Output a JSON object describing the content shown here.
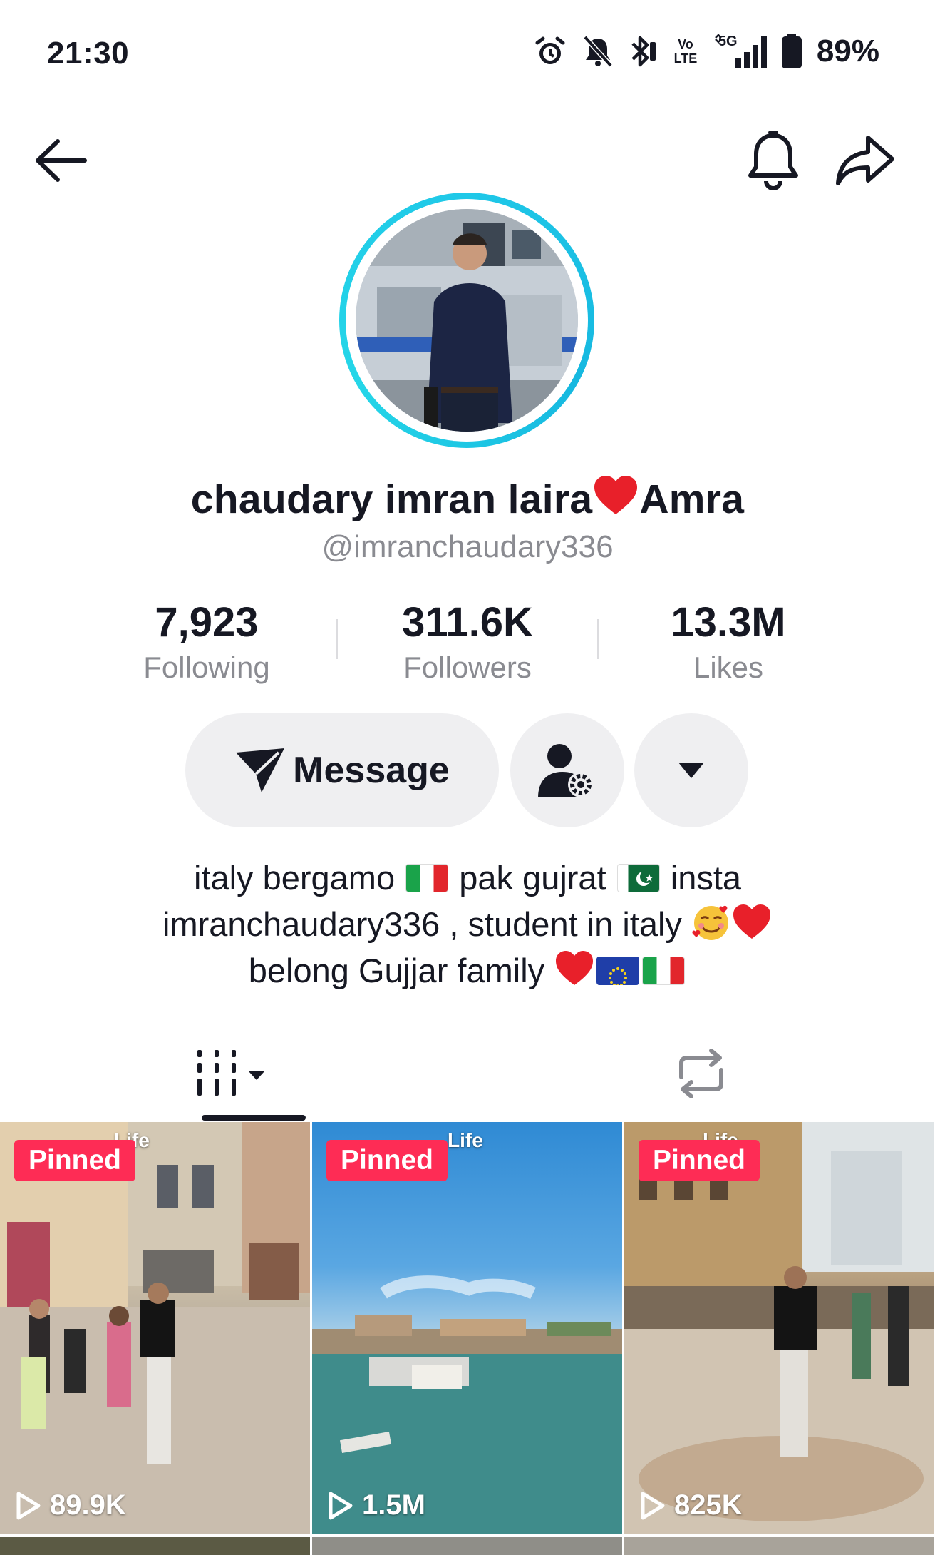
{
  "status_bar": {
    "time": "21:30",
    "battery": "89%",
    "network": "5G",
    "volte_top": "Vo",
    "volte_bottom": "LTE",
    "icons": [
      "alarm-icon",
      "mute-icon",
      "bluetooth-icon",
      "volte-icon",
      "signal-icon",
      "battery-icon"
    ]
  },
  "nav": {
    "icons": [
      "back-arrow-icon",
      "bell-icon",
      "share-arrow-icon"
    ]
  },
  "profile": {
    "name_part1": "chaudary imran laira",
    "name_part2": "Amra",
    "username": "@imranchaudary336"
  },
  "stats": [
    {
      "value": "7,923",
      "label": "Following"
    },
    {
      "value": "311.6K",
      "label": "Followers"
    },
    {
      "value": "13.3M",
      "label": "Likes"
    }
  ],
  "actions": {
    "message_label": "Message"
  },
  "bio": {
    "line1_a": "italy bergamo",
    "line1_b": "pak gujrat",
    "line1_c": "insta",
    "line2_a": "imranchaudary336  , student in italy",
    "line3_a": "belong Gujjar family"
  },
  "tabs": [
    {
      "name": "videos",
      "icon": "video-grid-icon",
      "selected": true
    },
    {
      "name": "reposts",
      "icon": "repost-icon",
      "selected": false
    }
  ],
  "videos": [
    {
      "badge": "Pinned",
      "views": "89.9K",
      "overlay": "Life"
    },
    {
      "badge": "Pinned",
      "views": "1.5M",
      "overlay": "Life"
    },
    {
      "badge": "Pinned",
      "views": "825K",
      "overlay": "Life"
    }
  ],
  "colors": {
    "accent": "#fe2c55",
    "avatar_ring": "#1fc8e8",
    "button_bg": "#efeff1",
    "secondary_text": "#8a8b91"
  }
}
